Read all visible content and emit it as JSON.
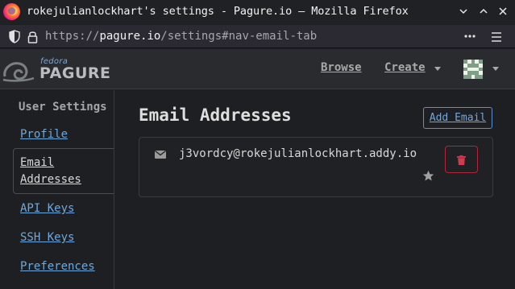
{
  "window": {
    "title": "rokejulianlockhart's settings - Pagure.io — Mozilla Firefox",
    "controls": [
      "chevron-down-icon",
      "chevron-up-icon",
      "close-icon"
    ]
  },
  "urlbar": {
    "scheme": "https://",
    "domain": "pagure.io",
    "path": "/settings#nav-email-tab"
  },
  "header": {
    "logo_small": "fedora",
    "logo_large": "PAGURE",
    "nav": {
      "browse": "Browse",
      "create": "Create"
    }
  },
  "sidebar": {
    "heading": "User Settings",
    "items": [
      {
        "label": "Profile",
        "active": false
      },
      {
        "label": "Email Addresses",
        "active": true
      },
      {
        "label": "API Keys",
        "active": false
      },
      {
        "label": "SSH Keys",
        "active": false
      },
      {
        "label": "Preferences",
        "active": false
      }
    ]
  },
  "main": {
    "title": "Email Addresses",
    "add_button": "Add Email",
    "emails": [
      {
        "address": "j3vordcy@rokejulianlockhart.addy.io",
        "default": true
      }
    ]
  },
  "colors": {
    "link": "#6fa8dc",
    "danger": "#b0273b",
    "background": "#1e1f22"
  }
}
